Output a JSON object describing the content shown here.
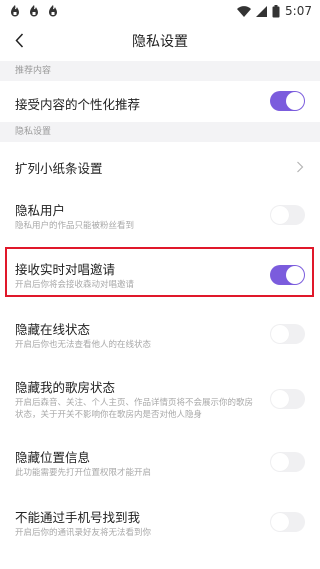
{
  "status_bar": {
    "time": "5:07"
  },
  "nav": {
    "title": "隐私设置"
  },
  "sections": {
    "recommend": "推荐内容",
    "privacy": "隐私设置"
  },
  "rows": {
    "personalized": {
      "title": "接受内容的个性化推荐",
      "toggle_on": true
    },
    "paper_slip": {
      "title": "扩列小纸条设置"
    },
    "private_user": {
      "title": "隐私用户",
      "subtitle": "隐私用户的作品只能被粉丝看到",
      "toggle_on": false
    },
    "chorus_invite": {
      "title": "接收实时对唱邀请",
      "subtitle": "开启后你将会接收森动对唱邀请",
      "toggle_on": true
    },
    "hide_online": {
      "title": "隐藏在线状态",
      "subtitle": "开启后你也无法查看他人的在线状态",
      "toggle_on": false
    },
    "hide_room": {
      "title": "隐藏我的歌房状态",
      "subtitle": "开启后森音、关注、个人主页、作品详情页将不会展示你的歌房状态，关于开关不影响你在歌房内是否对他人隐身",
      "toggle_on": false
    },
    "hide_location": {
      "title": "隐藏位置信息",
      "subtitle": "此功能需要先打开位置权限才能开启",
      "toggle_on": false
    },
    "phone_search": {
      "title": "不能通过手机号找到我",
      "subtitle": "开启后你的通讯录好友将无法看到你",
      "toggle_on": false
    }
  },
  "colors": {
    "accent": "#7b5cdd",
    "highlight": "#e0182a"
  }
}
